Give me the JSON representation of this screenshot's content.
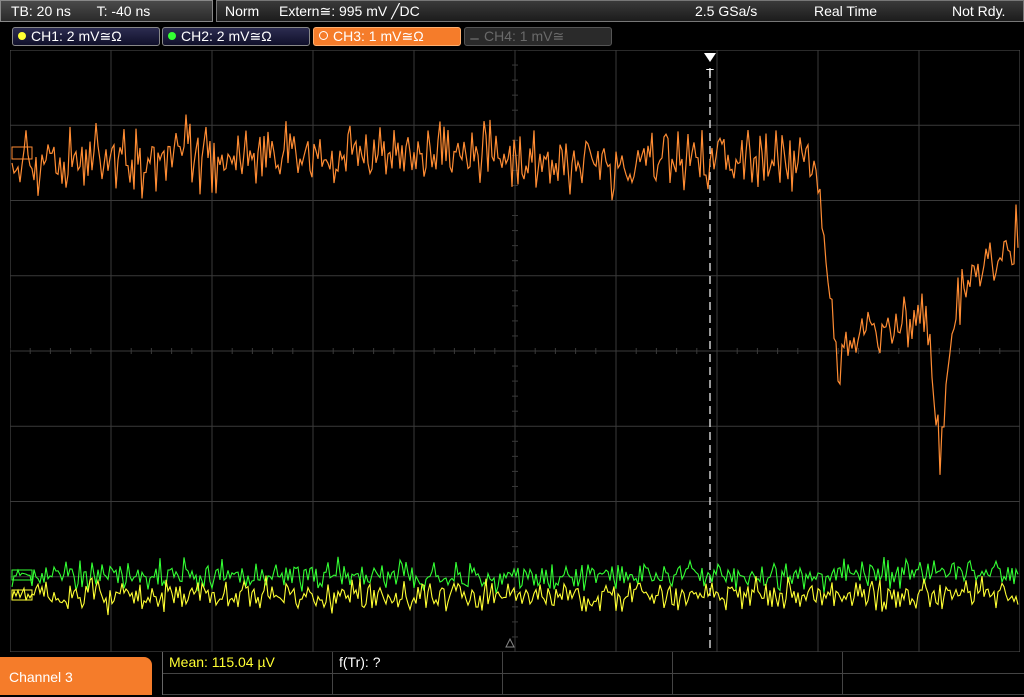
{
  "top_left": {
    "timebase": "TB: 20 ns",
    "trigger_time": "T: -40 ns"
  },
  "status": {
    "mode": "Norm",
    "trigger_source": "Extern≅: 995 mV ╱DC",
    "sample_rate": "2.5 GSa/s",
    "acquisition": "Real Time",
    "state": "Not Rdy."
  },
  "channels": [
    {
      "label": "CH1: 2 mV≅Ω",
      "color": "#ffff33",
      "state": "on"
    },
    {
      "label": "CH2: 2 mV≅Ω",
      "color": "#33ff33",
      "state": "on"
    },
    {
      "label": "CH3: 1 mV≅Ω",
      "color": "#ff8c33",
      "state": "active"
    },
    {
      "label": "CH4: 1 mV≅",
      "color": "#6a6a6a",
      "state": "off"
    }
  ],
  "trigger_marker": "T",
  "colors": {
    "ch1": "#ffff33",
    "ch2": "#33ff33",
    "ch3": "#ff8c33",
    "grid": "#3a3a3a"
  },
  "bottom": {
    "channel_tab": "Channel 3",
    "mean": "Mean: 115.04 µV",
    "ftr": "f(Tr): ?"
  }
}
